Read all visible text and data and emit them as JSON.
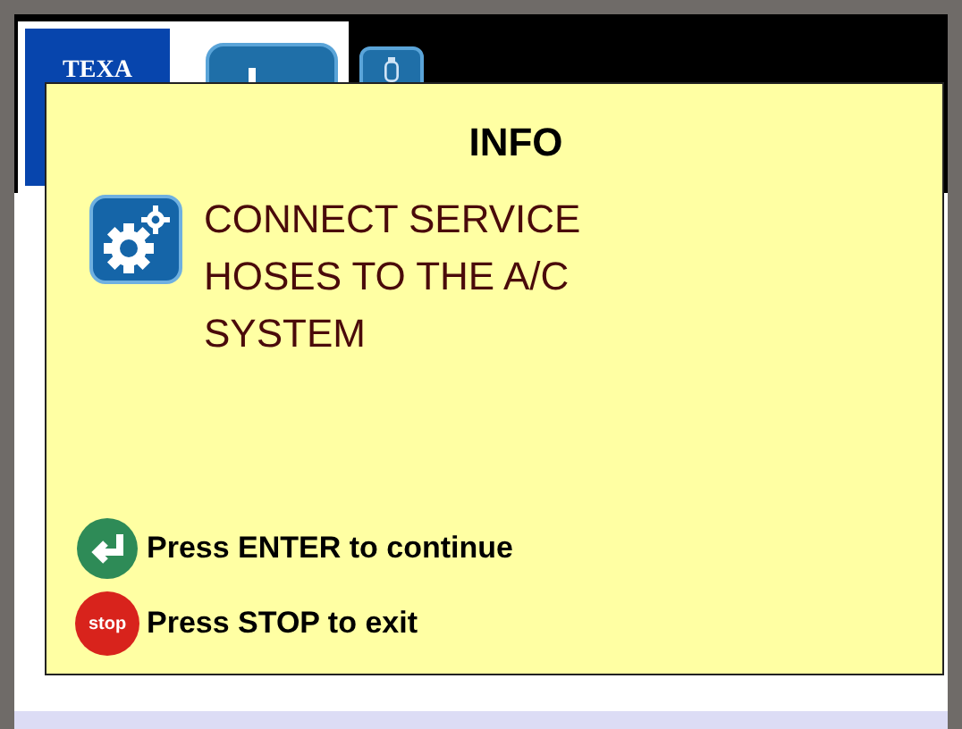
{
  "header": {
    "logo_text": "TEXA"
  },
  "dialog": {
    "title": "INFO",
    "message_lines": [
      "CONNECT SERVICE",
      "HOSES TO THE A/C",
      "SYSTEM"
    ],
    "actions": [
      {
        "kind": "enter",
        "label": "Press ENTER to continue"
      },
      {
        "kind": "stop",
        "label": "Press STOP to exit",
        "icon_text": "stop"
      }
    ]
  }
}
